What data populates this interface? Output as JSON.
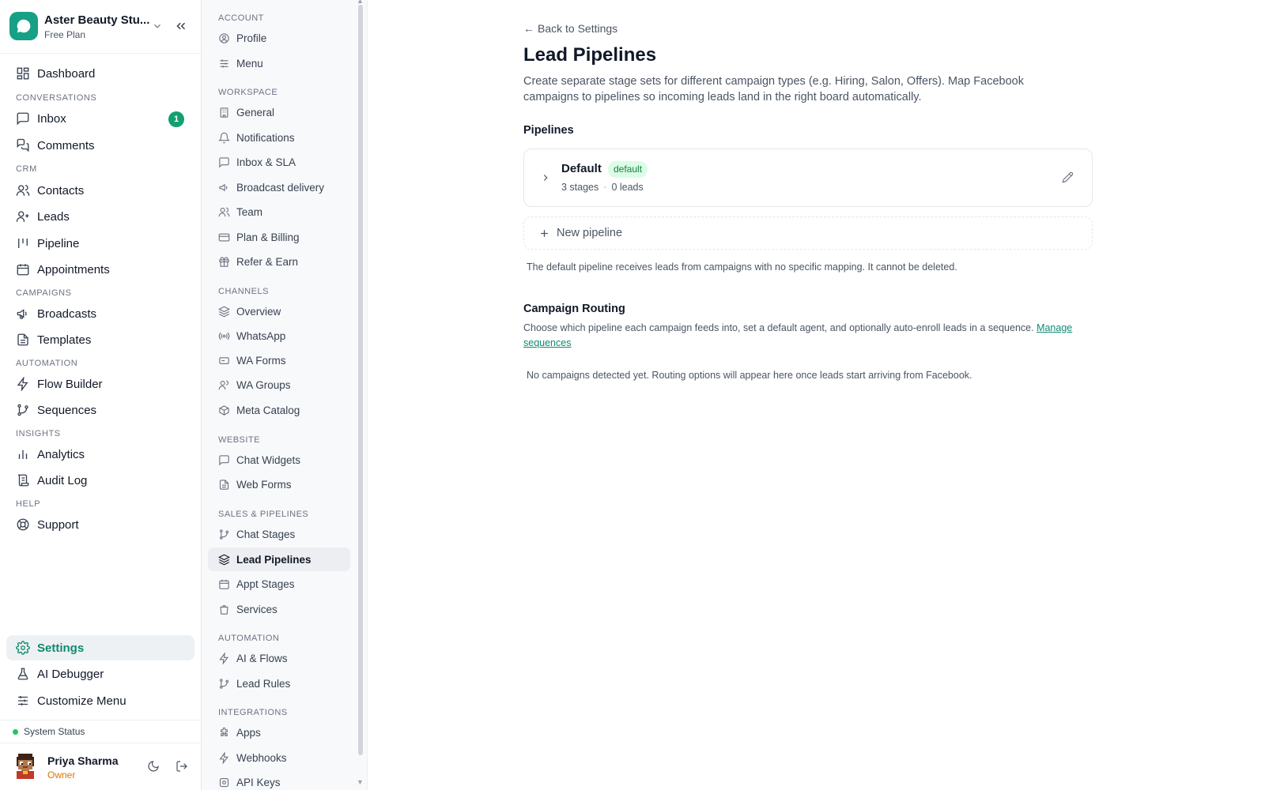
{
  "brand": {
    "name": "Aster Beauty Stu...",
    "plan": "Free Plan"
  },
  "nav": {
    "dashboard": "Dashboard",
    "sec_conversations": "CONVERSATIONS",
    "inbox": "Inbox",
    "inbox_badge": "1",
    "comments": "Comments",
    "sec_crm": "CRM",
    "contacts": "Contacts",
    "leads": "Leads",
    "pipeline": "Pipeline",
    "appointments": "Appointments",
    "sec_campaigns": "CAMPAIGNS",
    "broadcasts": "Broadcasts",
    "templates": "Templates",
    "sec_automation": "AUTOMATION",
    "flow_builder": "Flow Builder",
    "sequences": "Sequences",
    "sec_insights": "INSIGHTS",
    "analytics": "Analytics",
    "audit_log": "Audit Log",
    "sec_help": "HELP",
    "support": "Support",
    "settings": "Settings",
    "ai_debugger": "AI Debugger",
    "customize_menu": "Customize Menu"
  },
  "status": {
    "label": "System Status",
    "color": "#22c55e"
  },
  "user": {
    "name": "Priya Sharma",
    "role": "Owner"
  },
  "subnav": {
    "sec_account": "ACCOUNT",
    "profile": "Profile",
    "menu": "Menu",
    "sec_workspace": "WORKSPACE",
    "general": "General",
    "notifications": "Notifications",
    "inbox_sla": "Inbox & SLA",
    "broadcast_delivery": "Broadcast delivery",
    "team": "Team",
    "plan_billing": "Plan & Billing",
    "refer_earn": "Refer & Earn",
    "sec_channels": "CHANNELS",
    "overview": "Overview",
    "whatsapp": "WhatsApp",
    "wa_forms": "WA Forms",
    "wa_groups": "WA Groups",
    "meta_catalog": "Meta Catalog",
    "sec_website": "WEBSITE",
    "chat_widgets": "Chat Widgets",
    "web_forms": "Web Forms",
    "sec_sales": "SALES & PIPELINES",
    "chat_stages": "Chat Stages",
    "lead_pipelines": "Lead Pipelines",
    "appt_stages": "Appt Stages",
    "services": "Services",
    "sec_automation": "AUTOMATION",
    "ai_flows": "AI & Flows",
    "lead_rules": "Lead Rules",
    "sec_integrations": "INTEGRATIONS",
    "apps": "Apps",
    "webhooks": "Webhooks",
    "api_keys": "API Keys"
  },
  "main": {
    "back_arrow": "←",
    "back_label": "Back to Settings",
    "title": "Lead Pipelines",
    "description": "Create separate stage sets for different campaign types (e.g. Hiring, Salon, Offers). Map Facebook campaigns to pipelines so incoming leads land in the right board automatically.",
    "pipelines_heading": "Pipelines",
    "pipelines": [
      {
        "name": "Default",
        "badge": "default",
        "stages": "3 stages",
        "sep": "·",
        "leads": "0 leads"
      }
    ],
    "new_pipeline": "New pipeline",
    "pipeline_note": "The default pipeline receives leads from campaigns with no specific mapping. It cannot be deleted.",
    "routing_heading": "Campaign Routing",
    "routing_description": "Choose which pipeline each campaign feeds into, set a default agent, and optionally auto-enroll leads in a sequence.",
    "routing_link": "Manage sequences",
    "routing_empty": "No campaigns detected yet. Routing options will appear here once leads start arriving from Facebook."
  },
  "colors": {
    "accent": "#0f8a6e",
    "badge_bg": "#dcfce7",
    "badge_text": "#15803d",
    "owner_role": "#d97706"
  }
}
